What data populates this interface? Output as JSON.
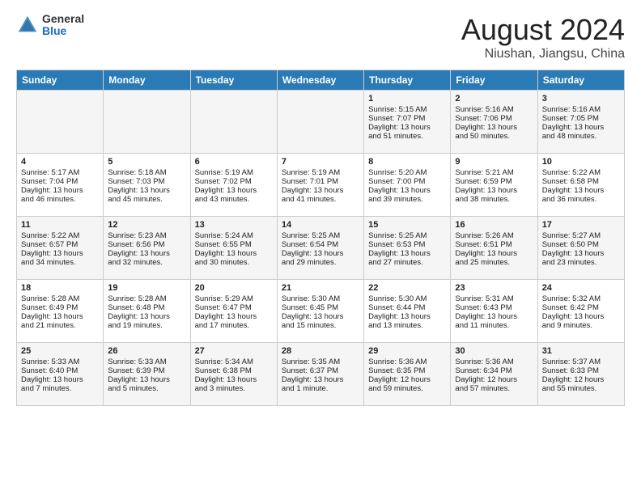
{
  "logo": {
    "general": "General",
    "blue": "Blue"
  },
  "title": {
    "month_year": "August 2024",
    "location": "Niushan, Jiangsu, China"
  },
  "headers": [
    "Sunday",
    "Monday",
    "Tuesday",
    "Wednesday",
    "Thursday",
    "Friday",
    "Saturday"
  ],
  "weeks": [
    [
      {
        "day": "",
        "info": ""
      },
      {
        "day": "",
        "info": ""
      },
      {
        "day": "",
        "info": ""
      },
      {
        "day": "",
        "info": ""
      },
      {
        "day": "1",
        "info": "Sunrise: 5:15 AM\nSunset: 7:07 PM\nDaylight: 13 hours\nand 51 minutes."
      },
      {
        "day": "2",
        "info": "Sunrise: 5:16 AM\nSunset: 7:06 PM\nDaylight: 13 hours\nand 50 minutes."
      },
      {
        "day": "3",
        "info": "Sunrise: 5:16 AM\nSunset: 7:05 PM\nDaylight: 13 hours\nand 48 minutes."
      }
    ],
    [
      {
        "day": "4",
        "info": "Sunrise: 5:17 AM\nSunset: 7:04 PM\nDaylight: 13 hours\nand 46 minutes."
      },
      {
        "day": "5",
        "info": "Sunrise: 5:18 AM\nSunset: 7:03 PM\nDaylight: 13 hours\nand 45 minutes."
      },
      {
        "day": "6",
        "info": "Sunrise: 5:19 AM\nSunset: 7:02 PM\nDaylight: 13 hours\nand 43 minutes."
      },
      {
        "day": "7",
        "info": "Sunrise: 5:19 AM\nSunset: 7:01 PM\nDaylight: 13 hours\nand 41 minutes."
      },
      {
        "day": "8",
        "info": "Sunrise: 5:20 AM\nSunset: 7:00 PM\nDaylight: 13 hours\nand 39 minutes."
      },
      {
        "day": "9",
        "info": "Sunrise: 5:21 AM\nSunset: 6:59 PM\nDaylight: 13 hours\nand 38 minutes."
      },
      {
        "day": "10",
        "info": "Sunrise: 5:22 AM\nSunset: 6:58 PM\nDaylight: 13 hours\nand 36 minutes."
      }
    ],
    [
      {
        "day": "11",
        "info": "Sunrise: 5:22 AM\nSunset: 6:57 PM\nDaylight: 13 hours\nand 34 minutes."
      },
      {
        "day": "12",
        "info": "Sunrise: 5:23 AM\nSunset: 6:56 PM\nDaylight: 13 hours\nand 32 minutes."
      },
      {
        "day": "13",
        "info": "Sunrise: 5:24 AM\nSunset: 6:55 PM\nDaylight: 13 hours\nand 30 minutes."
      },
      {
        "day": "14",
        "info": "Sunrise: 5:25 AM\nSunset: 6:54 PM\nDaylight: 13 hours\nand 29 minutes."
      },
      {
        "day": "15",
        "info": "Sunrise: 5:25 AM\nSunset: 6:53 PM\nDaylight: 13 hours\nand 27 minutes."
      },
      {
        "day": "16",
        "info": "Sunrise: 5:26 AM\nSunset: 6:51 PM\nDaylight: 13 hours\nand 25 minutes."
      },
      {
        "day": "17",
        "info": "Sunrise: 5:27 AM\nSunset: 6:50 PM\nDaylight: 13 hours\nand 23 minutes."
      }
    ],
    [
      {
        "day": "18",
        "info": "Sunrise: 5:28 AM\nSunset: 6:49 PM\nDaylight: 13 hours\nand 21 minutes."
      },
      {
        "day": "19",
        "info": "Sunrise: 5:28 AM\nSunset: 6:48 PM\nDaylight: 13 hours\nand 19 minutes."
      },
      {
        "day": "20",
        "info": "Sunrise: 5:29 AM\nSunset: 6:47 PM\nDaylight: 13 hours\nand 17 minutes."
      },
      {
        "day": "21",
        "info": "Sunrise: 5:30 AM\nSunset: 6:45 PM\nDaylight: 13 hours\nand 15 minutes."
      },
      {
        "day": "22",
        "info": "Sunrise: 5:30 AM\nSunset: 6:44 PM\nDaylight: 13 hours\nand 13 minutes."
      },
      {
        "day": "23",
        "info": "Sunrise: 5:31 AM\nSunset: 6:43 PM\nDaylight: 13 hours\nand 11 minutes."
      },
      {
        "day": "24",
        "info": "Sunrise: 5:32 AM\nSunset: 6:42 PM\nDaylight: 13 hours\nand 9 minutes."
      }
    ],
    [
      {
        "day": "25",
        "info": "Sunrise: 5:33 AM\nSunset: 6:40 PM\nDaylight: 13 hours\nand 7 minutes."
      },
      {
        "day": "26",
        "info": "Sunrise: 5:33 AM\nSunset: 6:39 PM\nDaylight: 13 hours\nand 5 minutes."
      },
      {
        "day": "27",
        "info": "Sunrise: 5:34 AM\nSunset: 6:38 PM\nDaylight: 13 hours\nand 3 minutes."
      },
      {
        "day": "28",
        "info": "Sunrise: 5:35 AM\nSunset: 6:37 PM\nDaylight: 13 hours\nand 1 minute."
      },
      {
        "day": "29",
        "info": "Sunrise: 5:36 AM\nSunset: 6:35 PM\nDaylight: 12 hours\nand 59 minutes."
      },
      {
        "day": "30",
        "info": "Sunrise: 5:36 AM\nSunset: 6:34 PM\nDaylight: 12 hours\nand 57 minutes."
      },
      {
        "day": "31",
        "info": "Sunrise: 5:37 AM\nSunset: 6:33 PM\nDaylight: 12 hours\nand 55 minutes."
      }
    ]
  ]
}
